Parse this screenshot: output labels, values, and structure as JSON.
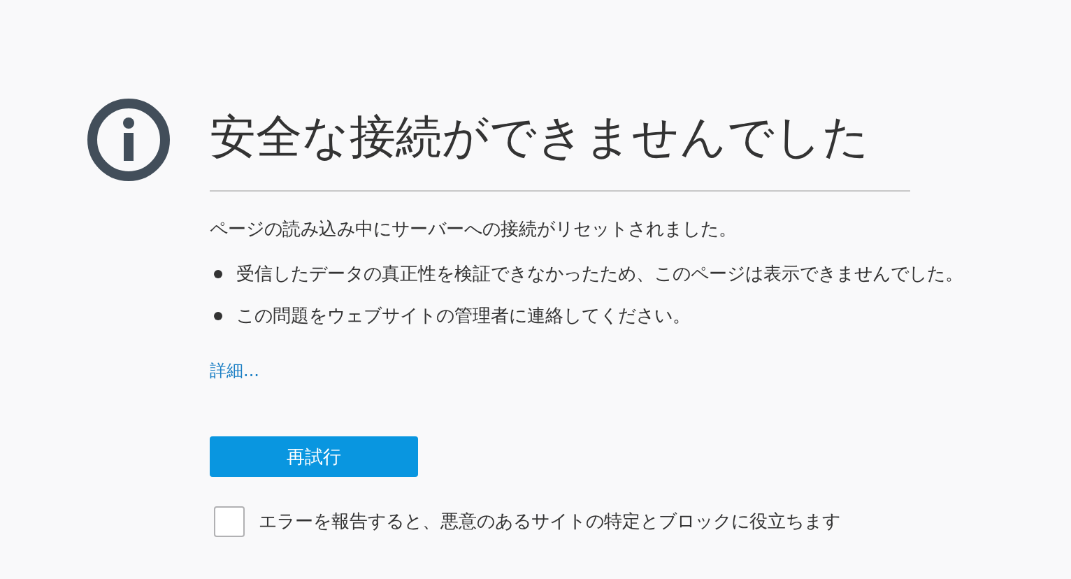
{
  "title": "安全な接続ができませんでした",
  "message": "ページの読み込み中にサーバーへの接続がリセットされました。",
  "bullets": [
    "受信したデータの真正性を検証できなかったため、このページは表示できませんでした。",
    "この問題をウェブサイトの管理者に連絡してください。"
  ],
  "details_link": "詳細...",
  "retry_button": "再試行",
  "report_checkbox": {
    "label": "エラーを報告すると、悪意のあるサイトの特定とブロックに役立ちます",
    "checked": false
  }
}
